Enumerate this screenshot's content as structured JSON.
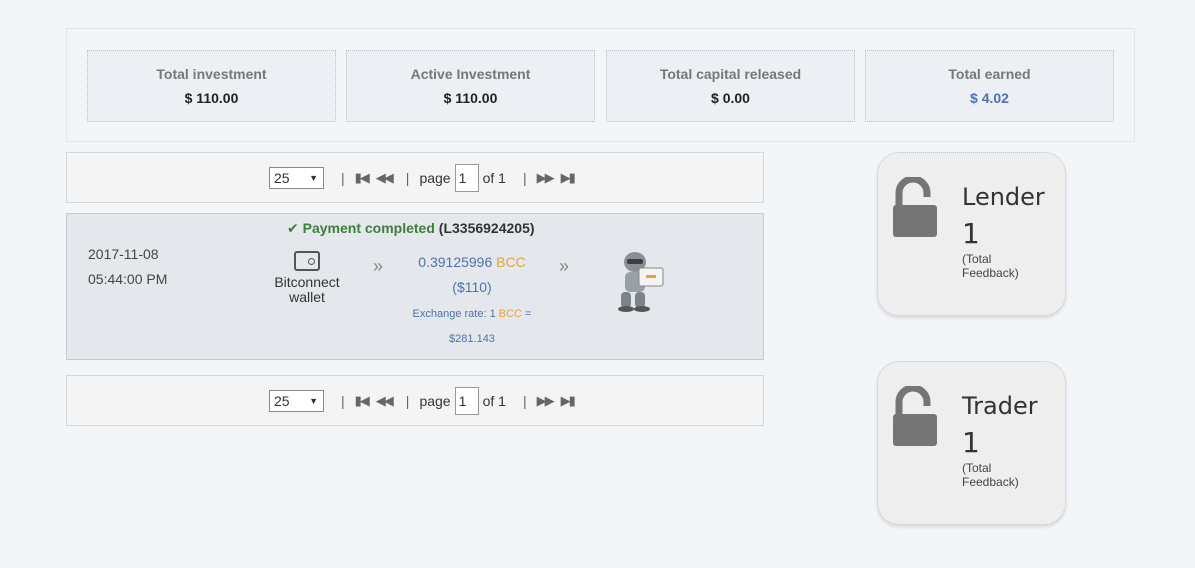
{
  "stats": [
    {
      "label": "Total investment",
      "value": "$ 110.00"
    },
    {
      "label": "Active Investment",
      "value": "$ 110.00"
    },
    {
      "label": "Total capital released",
      "value": "$ 0.00"
    },
    {
      "label": "Total earned",
      "value": "$ 4.02"
    }
  ],
  "pager": {
    "per_page": "25",
    "page_label": "page",
    "page_value": "1",
    "of_label": "of 1"
  },
  "transaction": {
    "status_label": "Payment completed",
    "ref": "(L3356924205)",
    "date": "2017-11-08",
    "time": "05:44:00 PM",
    "source_line1": "Bitconnect",
    "source_line2": "wallet",
    "amount": "0.39125996",
    "coin": "BCC",
    "usd": "($110)",
    "rate_prefix": "Exchange rate: 1",
    "rate_coin": "BCC",
    "rate_eq": "=",
    "rate_value": "$281.143"
  },
  "cards": [
    {
      "title": "Lender",
      "count": "1",
      "fb1": "(Total",
      "fb2": "Feedback)"
    },
    {
      "title": "Trader",
      "count": "1",
      "fb1": "(Total",
      "fb2": "Feedback)"
    }
  ],
  "icons": {
    "first": "first-page-icon",
    "prev": "previous-page-icon",
    "next": "next-page-icon",
    "last": "last-page-icon",
    "lock": "unlocked-padlock-icon"
  }
}
